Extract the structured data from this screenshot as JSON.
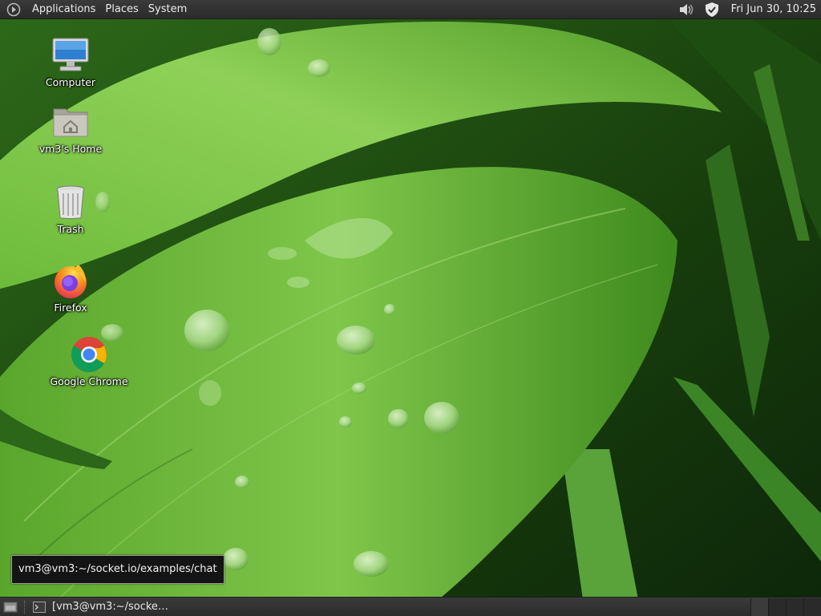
{
  "top_panel": {
    "menus": [
      "Applications",
      "Places",
      "System"
    ],
    "clock": "Fri Jun 30, 10:25",
    "tray": [
      "volume-icon",
      "shield-icon"
    ]
  },
  "desktop": {
    "icons": [
      {
        "label": "Computer",
        "icon": "computer-icon"
      },
      {
        "label": "vm3's Home",
        "icon": "home-folder-icon"
      },
      {
        "label": "Trash",
        "icon": "trash-icon"
      },
      {
        "label": "Firefox",
        "icon": "firefox-icon"
      },
      {
        "label": "Google Chrome",
        "icon": "chrome-icon"
      }
    ]
  },
  "tooltip": {
    "text": "vm3@vm3:~/socket.io/examples/chat"
  },
  "bottom_panel": {
    "task_label": "[vm3@vm3:~/socke…",
    "workspaces": 4,
    "active_workspace": 1
  },
  "colors": {
    "panel": "#2b2b2b",
    "leaf_light": "#7cc84a",
    "leaf_dark": "#1d4a10"
  }
}
